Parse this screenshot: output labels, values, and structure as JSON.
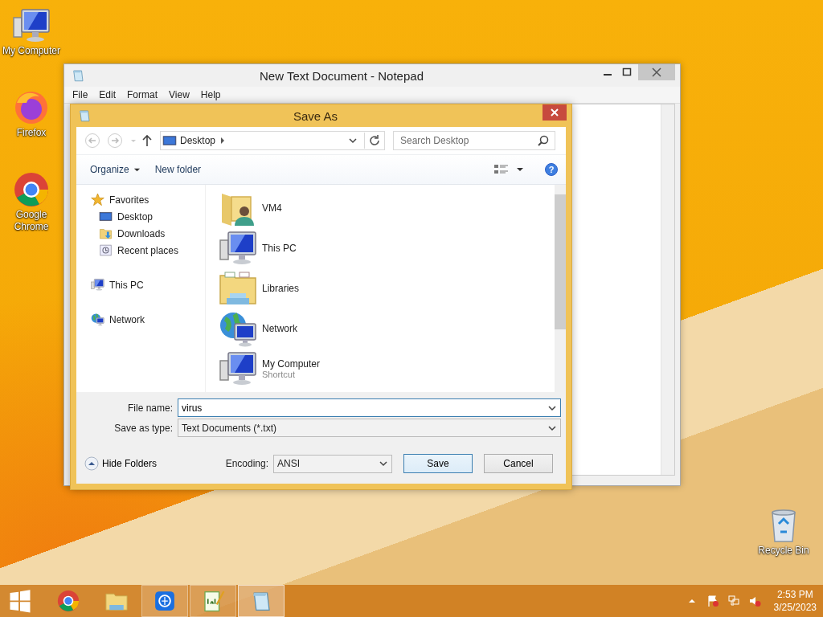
{
  "desktop_icons": [
    {
      "label": "My Computer",
      "kind": "pc"
    },
    {
      "label": "Firefox",
      "kind": "firefox"
    },
    {
      "label": "Google Chrome",
      "kind": "chrome"
    },
    {
      "label": "Recycle Bin",
      "kind": "recycle"
    }
  ],
  "notepad": {
    "title": "New Text Document - Notepad",
    "menu": [
      "File",
      "Edit",
      "Format",
      "View",
      "Help"
    ]
  },
  "save_as": {
    "title": "Save As",
    "address": "Desktop",
    "search_placeholder": "Search Desktop",
    "commands": [
      "Organize",
      "New folder"
    ],
    "nav": [
      {
        "label": "Favorites",
        "kind": "star",
        "children": [
          {
            "label": "Desktop",
            "kind": "desktop"
          },
          {
            "label": "Downloads",
            "kind": "downloads"
          },
          {
            "label": "Recent places",
            "kind": "recent"
          }
        ]
      },
      {
        "label": "This PC",
        "kind": "pc"
      },
      {
        "label": "Network",
        "kind": "network"
      }
    ],
    "files": [
      {
        "name": "VM4",
        "kind": "user-folder"
      },
      {
        "name": "This PC",
        "kind": "pc"
      },
      {
        "name": "Libraries",
        "kind": "libraries"
      },
      {
        "name": "Network",
        "kind": "network"
      },
      {
        "name": "My Computer",
        "subtitle": "Shortcut",
        "kind": "pc"
      }
    ],
    "file_name_label": "File name:",
    "file_name": "virus",
    "type_label": "Save as type:",
    "type": "Text Documents (*.txt)",
    "help_label": "?",
    "hide_folders": "Hide Folders",
    "encoding_label": "Encoding:",
    "encoding": "ANSI",
    "buttons": [
      "Save",
      "Cancel"
    ]
  },
  "taskbar": {
    "apps": [
      {
        "kind": "chrome",
        "open": false,
        "selected": false
      },
      {
        "kind": "explorer",
        "open": false,
        "selected": false
      },
      {
        "kind": "blue-app",
        "open": true,
        "selected": false
      },
      {
        "kind": "notepadpp",
        "open": true,
        "selected": false
      },
      {
        "kind": "notepad",
        "open": true,
        "selected": true
      }
    ],
    "time": "2:53 PM",
    "date": "3/25/2023"
  }
}
